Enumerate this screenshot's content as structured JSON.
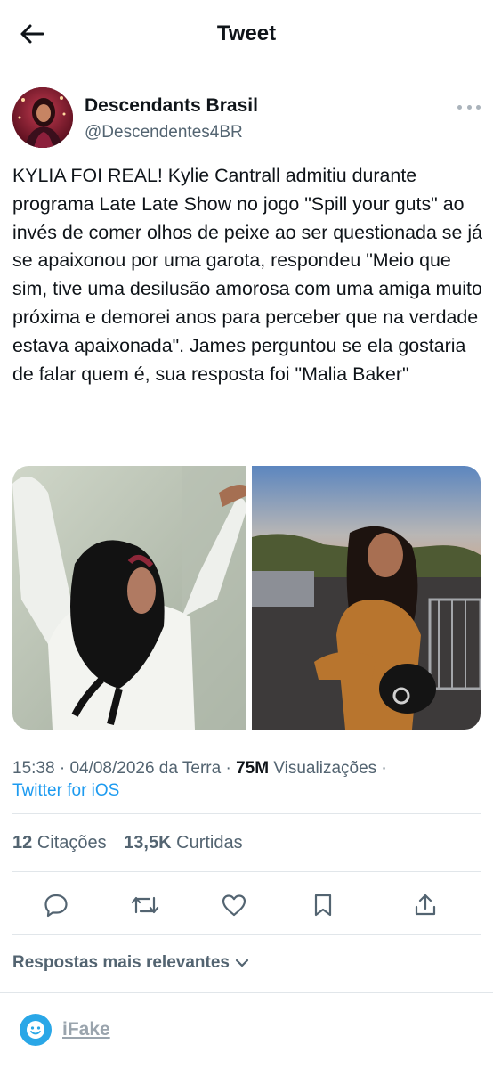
{
  "header": {
    "title": "Tweet",
    "back_icon": "arrow-left-icon"
  },
  "author": {
    "name": "Descendants Brasil",
    "handle": "@Descendentes4BR"
  },
  "tweet": {
    "text": "KYLIA FOI REAL! Kylie Cantrall admitiu durante programa Late Late Show no jogo \"Spill your guts\" ao invés de comer olhos de peixe ao ser questionada se já se apaixonou por uma garota, respondeu \"Meio que sim, tive uma desilusão amorosa com uma amiga muito próxima e demorei anos para perceber que na verdade estava apaixonada\". James perguntou se ela gostaria de falar quem é, sua resposta foi \"Malia Baker\""
  },
  "meta": {
    "time": "15:38",
    "date": "04/08/2026 da Terra",
    "views_count": "75M",
    "views_label": "Visualizações",
    "sep": "·",
    "source": "Twitter for iOS"
  },
  "stats": {
    "quotes_count": "12",
    "quotes_label": "Citações",
    "likes_count": "13,5K",
    "likes_label": "Curtidas"
  },
  "actions": {
    "icons": [
      "reply-icon",
      "retweet-icon",
      "like-icon",
      "bookmark-icon",
      "share-icon"
    ]
  },
  "replies": {
    "sort_label": "Respostas mais relevantes"
  },
  "credit": {
    "label": "iFake"
  },
  "colors": {
    "accent": "#1d9bf0",
    "text": "#0f1419",
    "secondary": "#536471",
    "divider": "#e1e6ea",
    "logo": "#2aa7e7"
  }
}
